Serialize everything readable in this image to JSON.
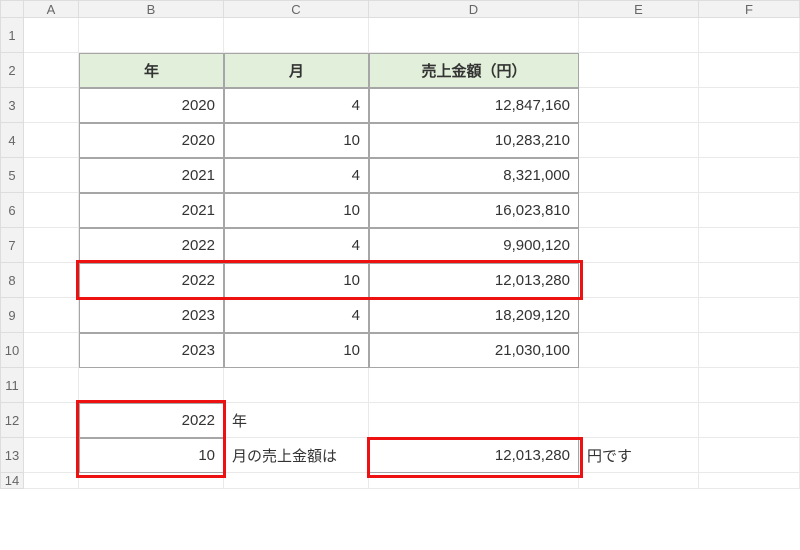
{
  "columns": [
    "A",
    "B",
    "C",
    "D",
    "E",
    "F"
  ],
  "rows": [
    "1",
    "2",
    "3",
    "4",
    "5",
    "6",
    "7",
    "8",
    "9",
    "10",
    "11",
    "12",
    "13",
    "14"
  ],
  "table": {
    "headers": {
      "year": "年",
      "month": "月",
      "amount": "売上金額（円）"
    },
    "data": [
      {
        "year": "2020",
        "month": "4",
        "amount": "12,847,160"
      },
      {
        "year": "2020",
        "month": "10",
        "amount": "10,283,210"
      },
      {
        "year": "2021",
        "month": "4",
        "amount": "8,321,000"
      },
      {
        "year": "2021",
        "month": "10",
        "amount": "16,023,810"
      },
      {
        "year": "2022",
        "month": "4",
        "amount": "9,900,120"
      },
      {
        "year": "2022",
        "month": "10",
        "amount": "12,013,280"
      },
      {
        "year": "2023",
        "month": "4",
        "amount": "18,209,120"
      },
      {
        "year": "2023",
        "month": "10",
        "amount": "21,030,100"
      }
    ]
  },
  "lookup": {
    "year_value": "2022",
    "year_suffix": "年",
    "month_value": "10",
    "month_suffix_text": "月の売上金額は",
    "result_value": "12,013,280",
    "result_suffix": "円です"
  },
  "chart_data": {
    "type": "table",
    "title": "売上金額（円）",
    "columns": [
      "年",
      "月",
      "売上金額（円）"
    ],
    "rows": [
      [
        2020,
        4,
        12847160
      ],
      [
        2020,
        10,
        10283210
      ],
      [
        2021,
        4,
        8321000
      ],
      [
        2021,
        10,
        16023810
      ],
      [
        2022,
        4,
        9900120
      ],
      [
        2022,
        10,
        12013280
      ],
      [
        2023,
        4,
        18209120
      ],
      [
        2023,
        10,
        21030100
      ]
    ]
  }
}
